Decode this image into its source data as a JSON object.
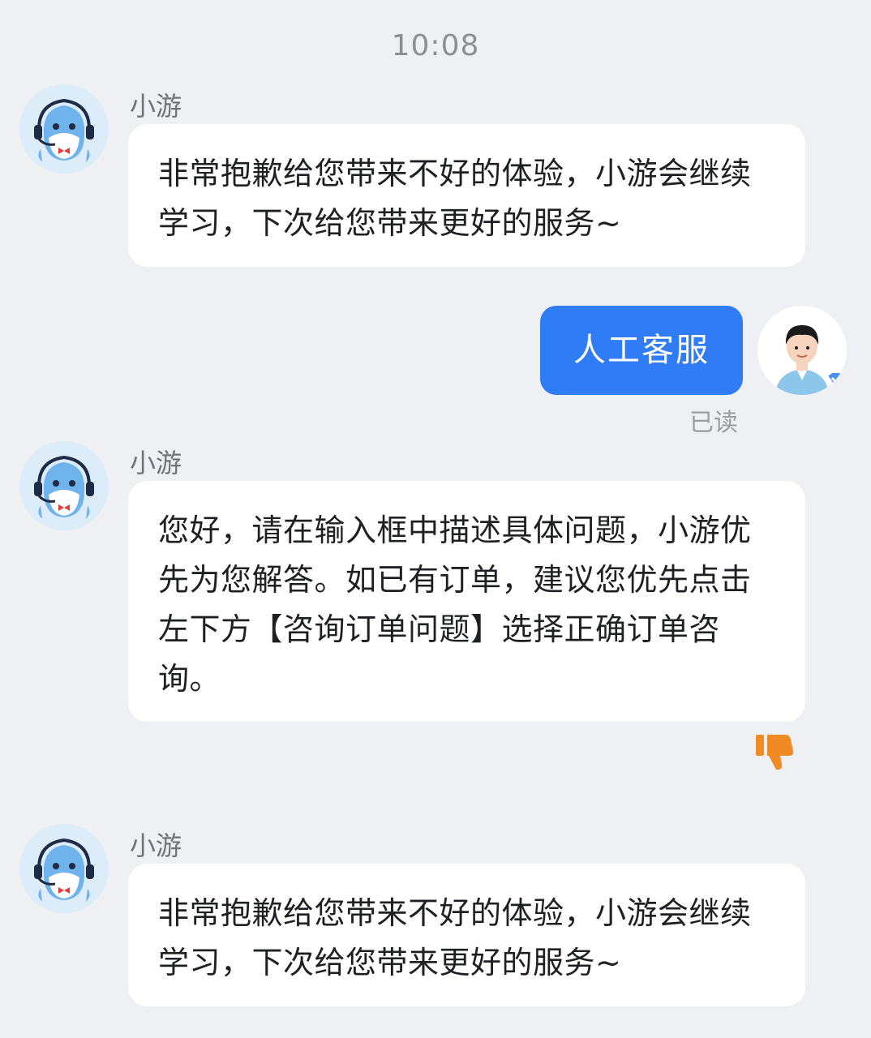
{
  "timestamp": "10:08",
  "bot_name": "小游",
  "messages": [
    {
      "sender": "小游",
      "text": "非常抱歉给您带来不好的体验，小游会继续学习，下次给您带来更好的服务~"
    },
    {
      "text": "人工客服",
      "status": "已读"
    },
    {
      "sender": "小游",
      "text": "您好，请在输入框中描述具体问题，小游优先为您解答。如已有订单，建议您优先点击左下方【咨询订单问题】选择正确订单咨询。"
    },
    {
      "sender": "小游",
      "text": "非常抱歉给您带来不好的体验，小游会继续学习，下次给您带来更好的服务~"
    }
  ],
  "icons": {
    "bot_avatar": "dolphin-headset-avatar",
    "user_avatar": "user-avatar-verified",
    "feedback": "thumbs-down-icon"
  },
  "colors": {
    "user_bubble": "#2f7cf6",
    "dislike": "#f08a24",
    "background": "#eef0f3"
  }
}
